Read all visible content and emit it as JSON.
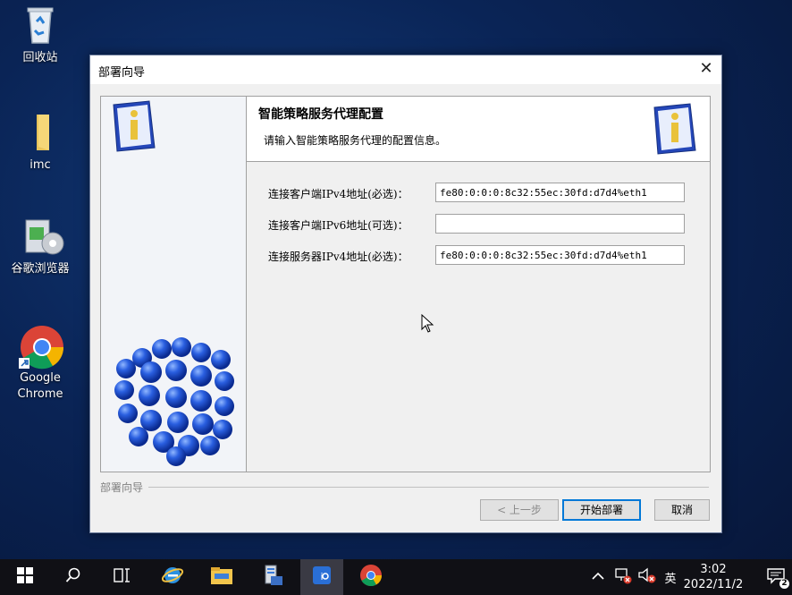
{
  "desktop": {
    "icons": [
      {
        "label": "回收站"
      },
      {
        "label": "imc"
      },
      {
        "label": "谷歌浏览器"
      },
      {
        "label": "Google Chrome"
      }
    ]
  },
  "dialog": {
    "title": "部署向导",
    "close_glyph": "✕",
    "header_title": "智能策略服务代理配置",
    "header_subtitle": "请输入智能策略服务代理的配置信息。",
    "fields": [
      {
        "label": "连接客户端IPv4地址(必选)：",
        "value": "fe80:0:0:0:8c32:55ec:30fd:d7d4%eth1"
      },
      {
        "label": "连接客户端IPv6地址(可选)：",
        "value": ""
      },
      {
        "label": "连接服务器IPv4地址(必选)：",
        "value": "fe80:0:0:0:8c32:55ec:30fd:d7d4%eth1"
      }
    ],
    "group_label": "部署向导",
    "buttons": {
      "prev": "< 上一步",
      "start": "开始部署",
      "cancel": "取消"
    }
  },
  "taskbar": {
    "ime": "英",
    "time": "3:02",
    "date": "2022/11/2",
    "notification_count": "2"
  }
}
